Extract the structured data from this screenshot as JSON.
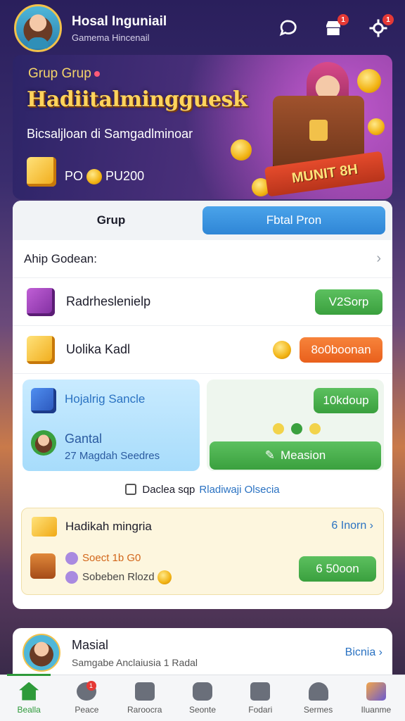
{
  "header": {
    "user_name": "Hosal Inguniail",
    "user_subtitle": "Gamema Hincenail",
    "chat_icon": "chat-bubble-icon",
    "store_icon": "store-icon",
    "store_badge": "1",
    "settings_icon": "settings-icon",
    "settings_badge": "1"
  },
  "banner": {
    "tag": "Grup Grup",
    "title": "Hadiitalmingguesk",
    "subtitle": "Bicsaljloan di Samgadlminoar",
    "points": "PO",
    "points_value": "PU200",
    "ribbon": "MUNIT 8H"
  },
  "tabs": [
    {
      "label": "Grup"
    },
    {
      "label": "Fbtal Pron"
    }
  ],
  "section": {
    "title": "Ahip Godean:"
  },
  "rows": [
    {
      "label": "Radrheslenielp",
      "button": "V2Sorp"
    },
    {
      "label": "Uolika Kadl",
      "button": "8o0boonan"
    }
  ],
  "tile_left": {
    "title": "Hojalrig Sancle",
    "name": "Gantal",
    "detail": "27 Magdah Seedres"
  },
  "tile_right": {
    "top_button": "10kdoup",
    "bottom_button": "Measion"
  },
  "note": {
    "text": "Daclea sqp",
    "link": "Rladiwaji Olsecia"
  },
  "promo": {
    "title": "Hadikah mingria",
    "link": "6 Inorn",
    "line1": "Soect 1b G0",
    "line2": "Sobeben Rlozd",
    "button": "6 50oon"
  },
  "profile": {
    "name": "Masial",
    "subtitle": "Samgabe Anclaiusia 1 Radal",
    "link": "Bicnia"
  },
  "bottom_nav": [
    {
      "label": "Bealla",
      "icon": "home-icon"
    },
    {
      "label": "Peace",
      "icon": "chat-icon",
      "badge": "1"
    },
    {
      "label": "Raroocra",
      "icon": "photo-icon"
    },
    {
      "label": "Seonte",
      "icon": "camera-icon"
    },
    {
      "label": "Fodari",
      "icon": "list-icon"
    },
    {
      "label": "Sermes",
      "icon": "person-icon"
    },
    {
      "label": "Iluanme",
      "icon": "profile-icon"
    }
  ],
  "colors": {
    "accent_green": "#3aa03e",
    "accent_blue": "#2f86d6",
    "accent_orange": "#e9601c",
    "badge_red": "#e53935"
  }
}
